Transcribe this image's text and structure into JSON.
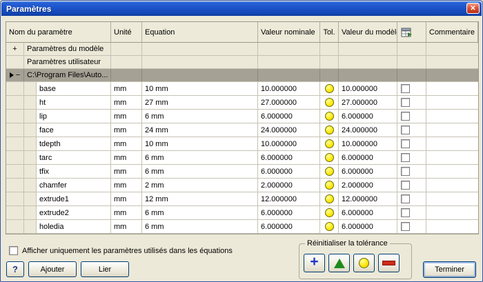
{
  "window": {
    "title": "Paramètres",
    "close_glyph": "✕"
  },
  "table": {
    "headers": {
      "name": "Nom du paramètre",
      "unit": "Unité",
      "equation": "Equation",
      "nominal": "Valeur nominale",
      "tol": "Tol.",
      "model": "Valeur du modèle",
      "export": "",
      "comment": "Commentaire"
    },
    "groups": [
      {
        "indicator": "+",
        "label": "Paramètres du modèle"
      },
      {
        "indicator": "",
        "label": "Paramètres utilisateur"
      },
      {
        "indicator": "−",
        "label": "C:\\Program Files\\Auto..."
      }
    ],
    "rows": [
      {
        "name": "base",
        "unit": "mm",
        "equation": "10 mm",
        "nominal": "10.000000",
        "model": "10.000000",
        "comment": ""
      },
      {
        "name": "ht",
        "unit": "mm",
        "equation": "27 mm",
        "nominal": "27.000000",
        "model": "27.000000",
        "comment": ""
      },
      {
        "name": "lip",
        "unit": "mm",
        "equation": "6 mm",
        "nominal": "6.000000",
        "model": "6.000000",
        "comment": ""
      },
      {
        "name": "face",
        "unit": "mm",
        "equation": "24 mm",
        "nominal": "24.000000",
        "model": "24.000000",
        "comment": ""
      },
      {
        "name": "tdepth",
        "unit": "mm",
        "equation": "10 mm",
        "nominal": "10.000000",
        "model": "10.000000",
        "comment": ""
      },
      {
        "name": "tarc",
        "unit": "mm",
        "equation": "6 mm",
        "nominal": "6.000000",
        "model": "6.000000",
        "comment": ""
      },
      {
        "name": "tfix",
        "unit": "mm",
        "equation": "6 mm",
        "nominal": "6.000000",
        "model": "6.000000",
        "comment": ""
      },
      {
        "name": "chamfer",
        "unit": "mm",
        "equation": "2 mm",
        "nominal": "2.000000",
        "model": "2.000000",
        "comment": ""
      },
      {
        "name": "extrude1",
        "unit": "mm",
        "equation": "12 mm",
        "nominal": "12.000000",
        "model": "12.000000",
        "comment": ""
      },
      {
        "name": "extrude2",
        "unit": "mm",
        "equation": "6 mm",
        "nominal": "6.000000",
        "model": "6.000000",
        "comment": ""
      },
      {
        "name": "holedia",
        "unit": "mm",
        "equation": "6 mm",
        "nominal": "6.000000",
        "model": "6.000000",
        "comment": ""
      }
    ]
  },
  "footer": {
    "filter_label": "Afficher uniquement les paramètres utilisés dans les équations",
    "help_label": "?",
    "add_label": "Ajouter",
    "link_label": "Lier",
    "tolerance_group_label": "Réinitialiser la tolérance",
    "finish_label": "Terminer"
  },
  "colors": {
    "titlebar_blue": "#1C53C9",
    "selected_row_gray": "#A5A195",
    "tolerance_yellow": "#FFE800",
    "plus_blue": "#1F36C8",
    "triangle_green": "#1E8A1E",
    "minus_red": "#CE2B1C",
    "dialog_face": "#ECE9D8"
  }
}
